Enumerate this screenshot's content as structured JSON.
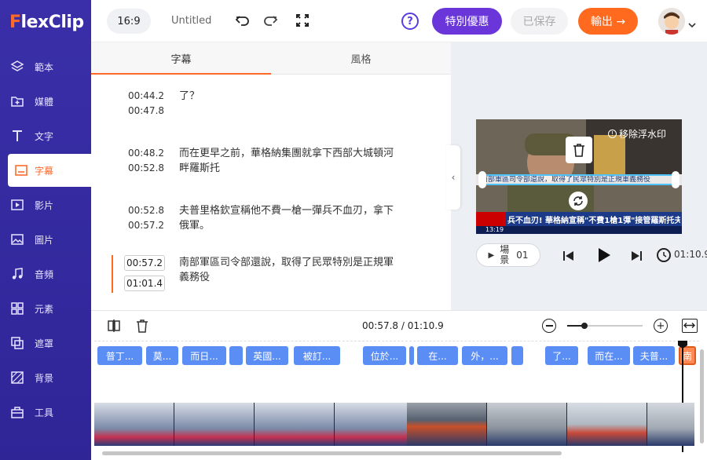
{
  "app": {
    "logo": "FlexClip"
  },
  "sidebar": {
    "items": [
      {
        "label": "範本",
        "icon": "layers-icon"
      },
      {
        "label": "媒體",
        "icon": "folder-icon"
      },
      {
        "label": "文字",
        "icon": "text-icon"
      },
      {
        "label": "字幕",
        "icon": "subtitle-icon",
        "active": true
      },
      {
        "label": "影片",
        "icon": "video-icon"
      },
      {
        "label": "圖片",
        "icon": "image-icon"
      },
      {
        "label": "音頻",
        "icon": "music-icon"
      },
      {
        "label": "元素",
        "icon": "shapes-icon"
      },
      {
        "label": "遮罩",
        "icon": "mask-icon"
      },
      {
        "label": "背景",
        "icon": "background-icon"
      },
      {
        "label": "工具",
        "icon": "toolbox-icon"
      }
    ]
  },
  "topbar": {
    "ratio": "16:9",
    "title": "Untitled",
    "promo": "特別優惠",
    "saved": "已保存",
    "export": "輸出 →"
  },
  "panel_tabs": [
    "字幕",
    "風格"
  ],
  "subtitles": [
    {
      "start": "00:44.2",
      "end": "00:47.8",
      "text": "了？"
    },
    {
      "start": "00:48.2",
      "end": "00:52.8",
      "text": "而在更早之前，華格納集團就拿下西部大城頓河畔羅斯托"
    },
    {
      "start": "00:52.8",
      "end": "00:57.2",
      "text": "夫普里格欽宣稱他不費一槍一彈兵不血刃，拿下俄軍。"
    },
    {
      "start": "00:57.2",
      "end": "01:01.4",
      "text": "南部軍區司令部還說，取得了民眾特別是正規軍義務役"
    }
  ],
  "preview": {
    "remove_watermark": "移除浮水印",
    "overlay_top": "南部軍區司令部還說，取得了民眾特別是正規軍義務役",
    "headline": "兵不血刃! 華格納宣稱\"不費1槍1彈\"接管羅斯托夫",
    "clock": "13:19",
    "scene_label": "場景",
    "scene_number": "01",
    "time": "01:10.9"
  },
  "timeline": {
    "time": "00:57.8 / 01:10.9",
    "chips": [
      "普丁...",
      "莫...",
      "而日...",
      "",
      "英國...",
      "被訂...",
      "位於...",
      "",
      "在...",
      "外，...",
      "",
      "了...",
      "而在...",
      "夫普...",
      "南"
    ]
  },
  "watermark": "http://www.xiaoyao.tw/"
}
